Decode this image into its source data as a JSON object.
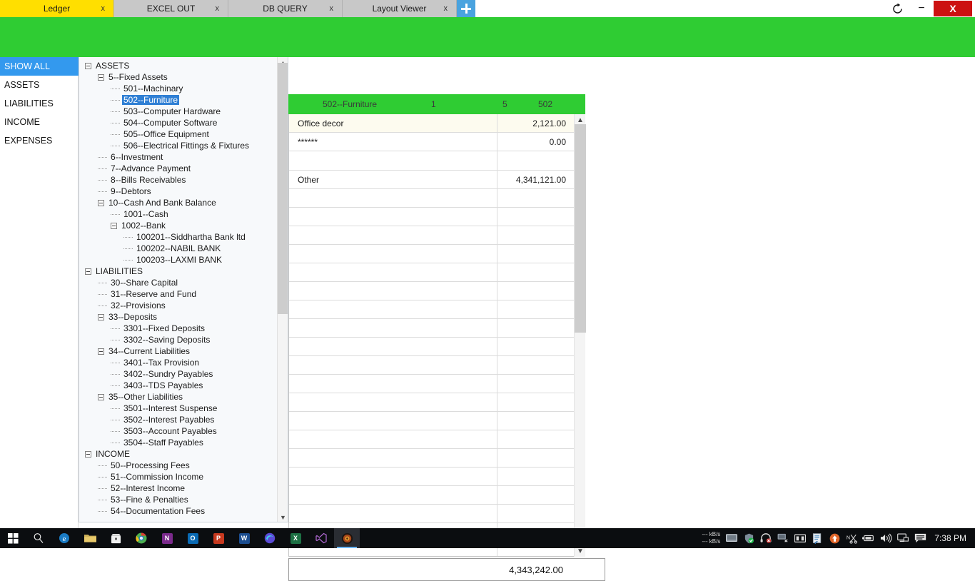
{
  "window": {
    "refresh_icon": "refresh-icon",
    "minimize_label": "−",
    "close_label": "X"
  },
  "tabs": [
    {
      "label": "Ledger",
      "close": "x",
      "active": true
    },
    {
      "label": "EXCEL OUT",
      "close": "x",
      "active": false
    },
    {
      "label": "DB QUERY",
      "close": "x",
      "active": false
    },
    {
      "label": "Layout Viewer",
      "close": "x",
      "active": false
    }
  ],
  "tab_add_label": "+",
  "sidebar": {
    "items": [
      {
        "label": "SHOW ALL",
        "selected": true
      },
      {
        "label": "ASSETS",
        "selected": false
      },
      {
        "label": "LIABILITIES",
        "selected": false
      },
      {
        "label": "INCOME",
        "selected": false
      },
      {
        "label": "EXPENSES",
        "selected": false
      }
    ]
  },
  "tree": {
    "nodes": [
      {
        "label": "ASSETS",
        "depth": 0,
        "expander": true,
        "selected": false
      },
      {
        "label": "5--Fixed Assets",
        "depth": 1,
        "expander": true,
        "selected": false
      },
      {
        "label": "501--Machinary",
        "depth": 2,
        "expander": false,
        "selected": false
      },
      {
        "label": "502--Furniture",
        "depth": 2,
        "expander": false,
        "selected": true
      },
      {
        "label": "503--Computer Hardware",
        "depth": 2,
        "expander": false,
        "selected": false
      },
      {
        "label": "504--Computer Software",
        "depth": 2,
        "expander": false,
        "selected": false
      },
      {
        "label": "505--Office Equipment",
        "depth": 2,
        "expander": false,
        "selected": false
      },
      {
        "label": "506--Electrical Fittings & Fixtures",
        "depth": 2,
        "expander": false,
        "selected": false
      },
      {
        "label": "6--Investment",
        "depth": 1,
        "expander": false,
        "selected": false
      },
      {
        "label": "7--Advance Payment",
        "depth": 1,
        "expander": false,
        "selected": false
      },
      {
        "label": "8--Bills Receivables",
        "depth": 1,
        "expander": false,
        "selected": false
      },
      {
        "label": "9--Debtors",
        "depth": 1,
        "expander": false,
        "selected": false
      },
      {
        "label": "10--Cash And Bank Balance",
        "depth": 1,
        "expander": true,
        "selected": false
      },
      {
        "label": "1001--Cash",
        "depth": 2,
        "expander": false,
        "selected": false
      },
      {
        "label": "1002--Bank",
        "depth": 2,
        "expander": true,
        "selected": false
      },
      {
        "label": "100201--Siddhartha Bank ltd",
        "depth": 3,
        "expander": false,
        "selected": false
      },
      {
        "label": "100202--NABIL BANK",
        "depth": 3,
        "expander": false,
        "selected": false
      },
      {
        "label": "100203--LAXMI BANK",
        "depth": 3,
        "expander": false,
        "selected": false
      },
      {
        "label": "LIABILITIES",
        "depth": 0,
        "expander": true,
        "selected": false
      },
      {
        "label": "30--Share Capital",
        "depth": 1,
        "expander": false,
        "selected": false
      },
      {
        "label": "31--Reserve and Fund",
        "depth": 1,
        "expander": false,
        "selected": false
      },
      {
        "label": "32--Provisions",
        "depth": 1,
        "expander": false,
        "selected": false
      },
      {
        "label": "33--Deposits",
        "depth": 1,
        "expander": true,
        "selected": false
      },
      {
        "label": "3301--Fixed Deposits",
        "depth": 2,
        "expander": false,
        "selected": false
      },
      {
        "label": "3302--Saving Deposits",
        "depth": 2,
        "expander": false,
        "selected": false
      },
      {
        "label": "34--Current Liabilities",
        "depth": 1,
        "expander": true,
        "selected": false
      },
      {
        "label": "3401--Tax Provision",
        "depth": 2,
        "expander": false,
        "selected": false
      },
      {
        "label": "3402--Sundry Payables",
        "depth": 2,
        "expander": false,
        "selected": false
      },
      {
        "label": "3403--TDS Payables",
        "depth": 2,
        "expander": false,
        "selected": false
      },
      {
        "label": "35--Other Liabilities",
        "depth": 1,
        "expander": true,
        "selected": false
      },
      {
        "label": "3501--Interest Suspense",
        "depth": 2,
        "expander": false,
        "selected": false
      },
      {
        "label": "3502--Interest Payables",
        "depth": 2,
        "expander": false,
        "selected": false
      },
      {
        "label": "3503--Account Payables",
        "depth": 2,
        "expander": false,
        "selected": false
      },
      {
        "label": "3504--Staff Payables",
        "depth": 2,
        "expander": false,
        "selected": false
      },
      {
        "label": "INCOME",
        "depth": 0,
        "expander": true,
        "selected": false
      },
      {
        "label": "50--Processing Fees",
        "depth": 1,
        "expander": false,
        "selected": false
      },
      {
        "label": "51--Commission Income",
        "depth": 1,
        "expander": false,
        "selected": false
      },
      {
        "label": "52--Interest Income",
        "depth": 1,
        "expander": false,
        "selected": false
      },
      {
        "label": "53--Fine & Penalties",
        "depth": 1,
        "expander": false,
        "selected": false
      },
      {
        "label": "54--Documentation Fees",
        "depth": 1,
        "expander": false,
        "selected": false
      }
    ]
  },
  "grid": {
    "header": {
      "name": "502--Furniture",
      "col_a": "1",
      "col_b": "5",
      "col_c": "502"
    },
    "rows": [
      {
        "name": "Office decor",
        "value": "2,121.00",
        "highlight": true
      },
      {
        "name": "******",
        "value": "0.00",
        "highlight": false
      },
      {
        "name": "",
        "value": "",
        "highlight": false
      },
      {
        "name": "Other",
        "value": "4,341,121.00",
        "highlight": false
      },
      {
        "name": "",
        "value": "",
        "highlight": false
      },
      {
        "name": "",
        "value": "",
        "highlight": false
      },
      {
        "name": "",
        "value": "",
        "highlight": false
      },
      {
        "name": "",
        "value": "",
        "highlight": false
      },
      {
        "name": "",
        "value": "",
        "highlight": false
      },
      {
        "name": "",
        "value": "",
        "highlight": false
      },
      {
        "name": "",
        "value": "",
        "highlight": false
      },
      {
        "name": "",
        "value": "",
        "highlight": false
      },
      {
        "name": "",
        "value": "",
        "highlight": false
      },
      {
        "name": "",
        "value": "",
        "highlight": false
      },
      {
        "name": "",
        "value": "",
        "highlight": false
      },
      {
        "name": "",
        "value": "",
        "highlight": false
      },
      {
        "name": "",
        "value": "",
        "highlight": false
      },
      {
        "name": "",
        "value": "",
        "highlight": false
      },
      {
        "name": "",
        "value": "",
        "highlight": false
      },
      {
        "name": "",
        "value": "",
        "highlight": false
      },
      {
        "name": "",
        "value": "",
        "highlight": false
      },
      {
        "name": "",
        "value": "",
        "highlight": false
      },
      {
        "name": "",
        "value": "",
        "highlight": false
      },
      {
        "name": "",
        "value": "",
        "highlight": false
      }
    ],
    "total": "4,343,242.00"
  },
  "taskbar": {
    "icons": [
      {
        "name": "start-icon",
        "glyph": "start"
      },
      {
        "name": "search-icon",
        "glyph": "search"
      },
      {
        "name": "edge-icon",
        "glyph": "e"
      },
      {
        "name": "file-explorer-icon",
        "glyph": "folder"
      },
      {
        "name": "microsoft-store-icon",
        "glyph": "store"
      },
      {
        "name": "chrome-icon",
        "glyph": "chrome"
      },
      {
        "name": "onenote-icon",
        "glyph": "N"
      },
      {
        "name": "outlook-icon",
        "glyph": "O"
      },
      {
        "name": "powerpoint-icon",
        "glyph": "P"
      },
      {
        "name": "word-icon",
        "glyph": "W"
      },
      {
        "name": "edge-beta-icon",
        "glyph": "s"
      },
      {
        "name": "excel-icon",
        "glyph": "X"
      },
      {
        "name": "visual-studio-icon",
        "glyph": "vs"
      },
      {
        "name": "ledger-app-icon",
        "glyph": "app",
        "active": true
      }
    ],
    "network_up": "--- kB/s",
    "network_down": "--- kB/s",
    "tray_icons": [
      "monitor-icon",
      "shield-check-icon",
      "headset-mute-icon",
      "network-settings-icon",
      "card-reader-icon",
      "document-sync-icon",
      "update-arrow-icon",
      "snip-tool-icon",
      "battery-icon",
      "volume-icon",
      "display-icon",
      "action-center-icon"
    ],
    "clock": "7:38 PM"
  },
  "colors": {
    "tab_active": "#ffdf00",
    "banner_green": "#2fcc33",
    "selected_blue": "#3399ee",
    "tree_selected": "#2f7fd4",
    "close_red": "#cc1111"
  }
}
